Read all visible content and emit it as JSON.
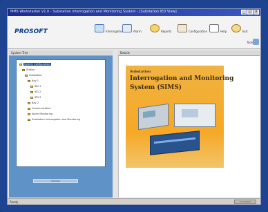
{
  "window": {
    "title": "MMS Workstation V1.0 - Substation Interrogation and Monitoring System - [Substation IED View]",
    "controls": {
      "minimize": "_",
      "maximize": "□",
      "close": "×"
    }
  },
  "toolbar": {
    "logo": "PROSOFT",
    "items": [
      {
        "label": "Interrogation",
        "icon": "monitor-icon"
      },
      {
        "label": "Alarm",
        "icon": "alarm-icon"
      },
      {
        "label": "Reports",
        "icon": "report-icon"
      },
      {
        "label": "Configuration",
        "icon": "config-icon"
      },
      {
        "label": "Help",
        "icon": "help-icon"
      },
      {
        "label": "Exit",
        "icon": "exit-icon"
      }
    ],
    "secondary_label": "Tools"
  },
  "left_panel": {
    "header": "System Tree",
    "tree": [
      {
        "label": "System Configuration",
        "level": 0,
        "selected": true
      },
      {
        "label": "Station",
        "level": 1
      },
      {
        "label": "Substation",
        "level": 2
      },
      {
        "label": "Bay 1",
        "level": 3
      },
      {
        "label": "IED 1",
        "level": 4
      },
      {
        "label": "IED 2",
        "level": 4
      },
      {
        "label": "IED 3",
        "level": 4
      },
      {
        "label": "Bay 2",
        "level": 3
      },
      {
        "label": "Communication",
        "level": 3
      },
      {
        "label": "Alarm Monitoring",
        "level": 3
      },
      {
        "label": "Substation Interrogation and Monitoring",
        "level": 3
      }
    ],
    "button_label": "Connect"
  },
  "right_panel": {
    "header": "Details",
    "poster": {
      "line1": "Substation",
      "line2": "Interrogation and Monitoring",
      "line3": "System (SIMS)"
    }
  },
  "statusbar": {
    "left": "Ready",
    "right": "Connected"
  }
}
